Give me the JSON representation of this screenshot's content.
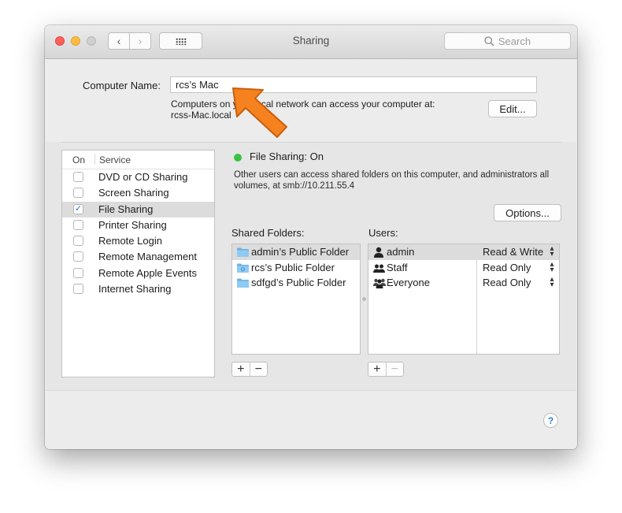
{
  "window": {
    "title": "Sharing",
    "search_placeholder": "Search"
  },
  "computer_name": {
    "label": "Computer Name:",
    "value": "rcs’s Mac",
    "description_line1": "Computers on your local network can access your computer at:",
    "description_line2": "rcss-Mac.local",
    "edit_label": "Edit..."
  },
  "services": {
    "header_on": "On",
    "header_service": "Service",
    "items": [
      {
        "label": "DVD or CD Sharing",
        "checked": false
      },
      {
        "label": "Screen Sharing",
        "checked": false
      },
      {
        "label": "File Sharing",
        "checked": true
      },
      {
        "label": "Printer Sharing",
        "checked": false
      },
      {
        "label": "Remote Login",
        "checked": false
      },
      {
        "label": "Remote Management",
        "checked": false
      },
      {
        "label": "Remote Apple Events",
        "checked": false
      },
      {
        "label": "Internet Sharing",
        "checked": false
      }
    ]
  },
  "file_sharing": {
    "status": "File Sharing: On",
    "status_color": "#39c343",
    "description": "Other users can access shared folders on this computer, and administrators all volumes, at smb://10.211.55.4",
    "options_label": "Options...",
    "shared_folders_label": "Shared Folders:",
    "users_label": "Users:",
    "folders": [
      {
        "name": "admin’s Public Folder"
      },
      {
        "name": "rcs’s Public Folder"
      },
      {
        "name": "sdfgd’s Public Folder"
      }
    ],
    "users": [
      {
        "name": "admin",
        "permission": "Read & Write",
        "icon": "single-user-icon"
      },
      {
        "name": "Staff",
        "permission": "Read Only",
        "icon": "group-icon"
      },
      {
        "name": "Everyone",
        "permission": "Read Only",
        "icon": "everyone-icon"
      }
    ],
    "add_label": "+",
    "remove_label": "−"
  },
  "help_label": "?",
  "annotation_color": "#f5821f"
}
